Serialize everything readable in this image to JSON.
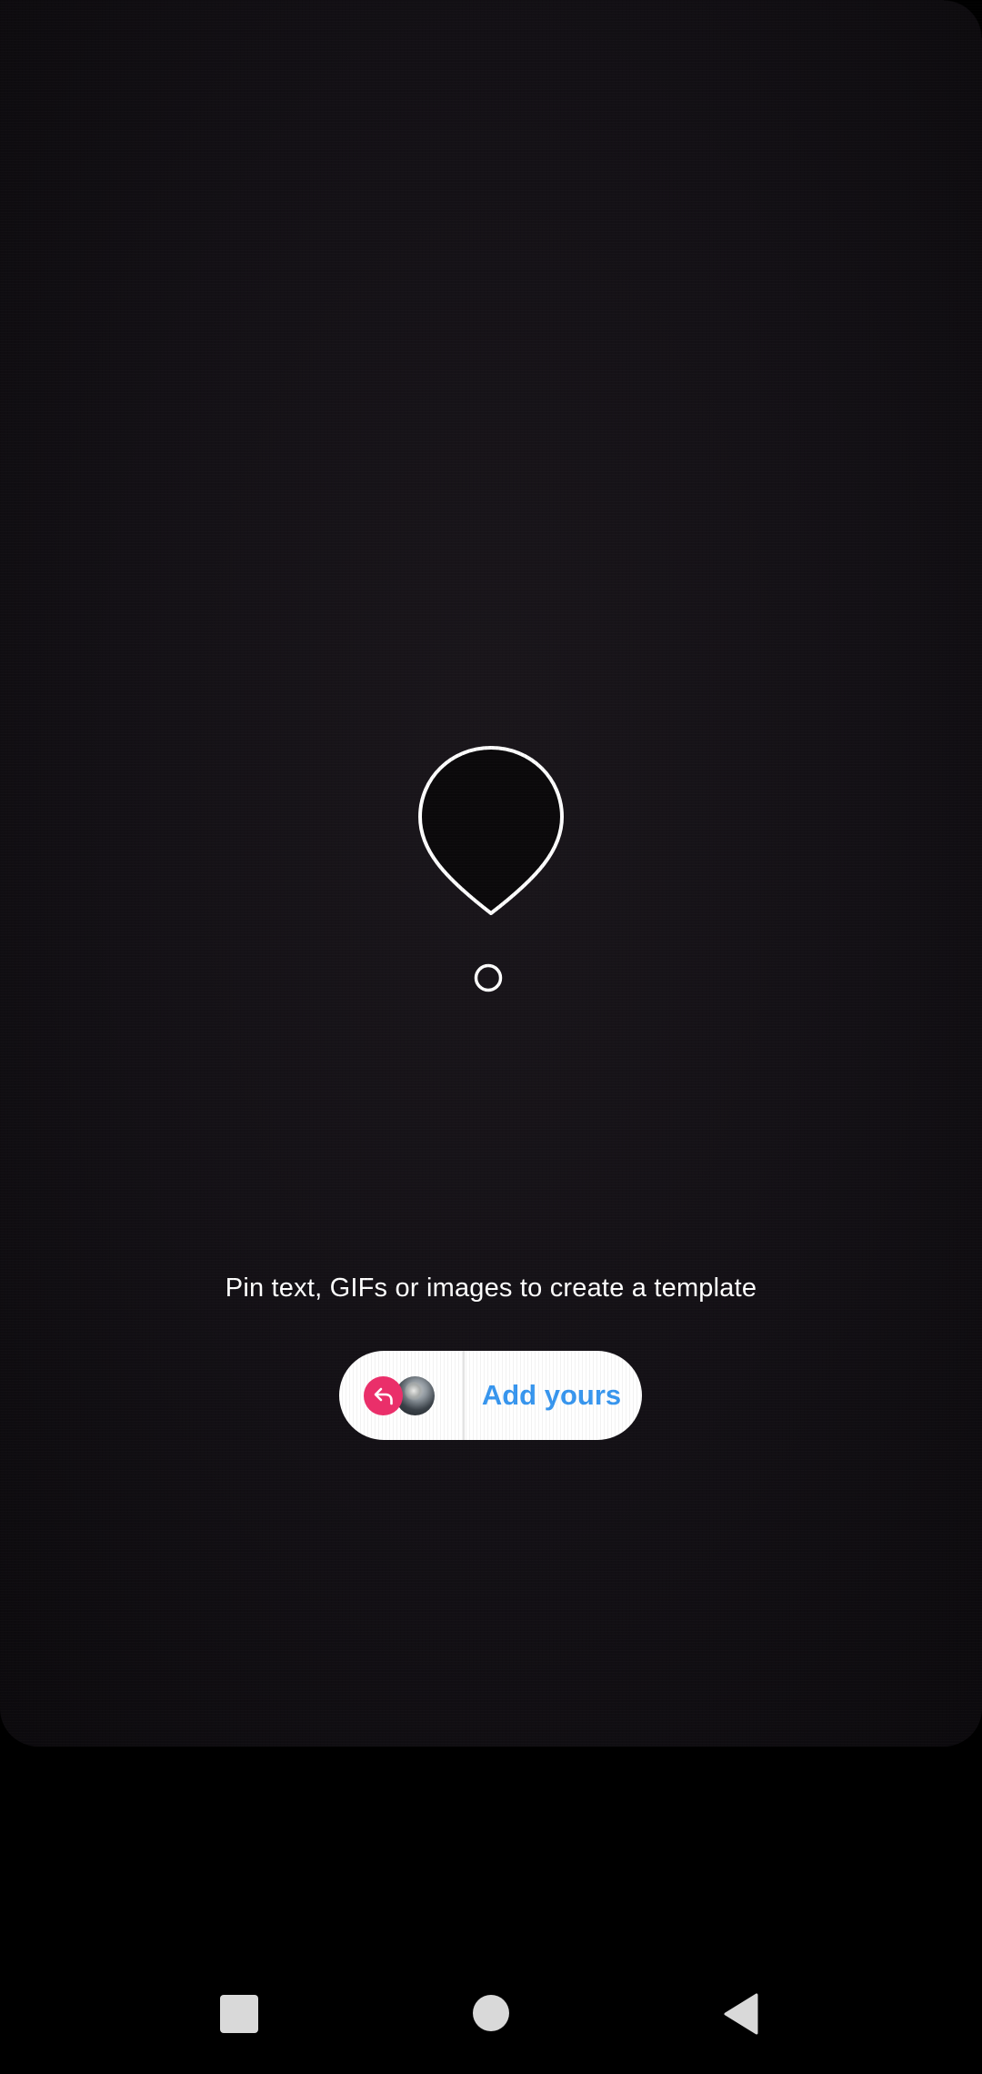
{
  "story_editor": {
    "hint_text": "Pin text, GIFs or images to create a template",
    "add_yours_sticker": {
      "label": "Add yours",
      "icons": [
        "reply-icon",
        "avatar"
      ],
      "accent_color": "#3897f0",
      "badge_color": "#ea2f6a"
    },
    "pin_icon": "map-pin-icon"
  },
  "system_nav": {
    "buttons": [
      "recents-button",
      "home-button",
      "back-button"
    ]
  }
}
